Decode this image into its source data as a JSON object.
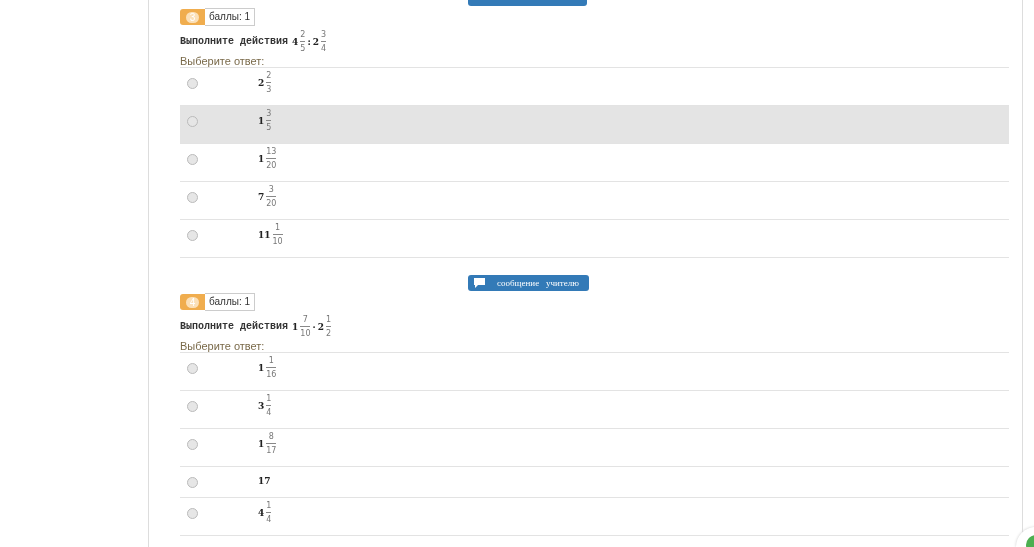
{
  "top_button": {
    "kind": "cut"
  },
  "questions": [
    {
      "number": "3",
      "points": "баллы: 1",
      "prompt": "Выполните действия",
      "expression": [
        {
          "kind": "mixed",
          "whole": "4",
          "num": "2",
          "den": "5"
        },
        {
          "kind": "operator",
          "text": ":"
        },
        {
          "kind": "mixed",
          "whole": "2",
          "num": "3",
          "den": "4"
        }
      ],
      "answer_label": "Выберите ответ:",
      "options": [
        {
          "answer": {
            "kind": "mixed",
            "whole": "2",
            "num": "2",
            "den": "3"
          },
          "selected": false,
          "highlighted": false
        },
        {
          "answer": {
            "kind": "mixed",
            "whole": "1",
            "num": "3",
            "den": "5"
          },
          "selected": false,
          "highlighted": true
        },
        {
          "answer": {
            "kind": "mixed",
            "whole": "1",
            "num": "13",
            "den": "20"
          },
          "selected": false,
          "highlighted": false
        },
        {
          "answer": {
            "kind": "mixed",
            "whole": "7",
            "num": "3",
            "den": "20"
          },
          "selected": false,
          "highlighted": false
        },
        {
          "answer": {
            "kind": "mixed",
            "whole": "11",
            "num": "1",
            "den": "10"
          },
          "selected": false,
          "highlighted": false
        }
      ]
    },
    {
      "number": "4",
      "points": "баллы: 1",
      "message_button": "сообщение   учителю",
      "prompt": "Выполните действия",
      "expression": [
        {
          "kind": "mixed",
          "whole": "1",
          "num": "7",
          "den": "10"
        },
        {
          "kind": "operator",
          "text": "·"
        },
        {
          "kind": "mixed",
          "whole": "2",
          "num": "1",
          "den": "2"
        }
      ],
      "answer_label": "Выберите ответ:",
      "options": [
        {
          "answer": {
            "kind": "mixed",
            "whole": "1",
            "num": "1",
            "den": "16"
          },
          "selected": false,
          "highlighted": false
        },
        {
          "answer": {
            "kind": "mixed",
            "whole": "3",
            "num": "1",
            "den": "4"
          },
          "selected": false,
          "highlighted": false
        },
        {
          "answer": {
            "kind": "mixed",
            "whole": "1",
            "num": "8",
            "den": "17"
          },
          "selected": false,
          "highlighted": false
        },
        {
          "answer": {
            "kind": "integer",
            "text": "17"
          },
          "selected": false,
          "highlighted": false
        },
        {
          "answer": {
            "kind": "mixed",
            "whole": "4",
            "num": "1",
            "den": "4"
          },
          "selected": false,
          "highlighted": false
        }
      ]
    }
  ]
}
